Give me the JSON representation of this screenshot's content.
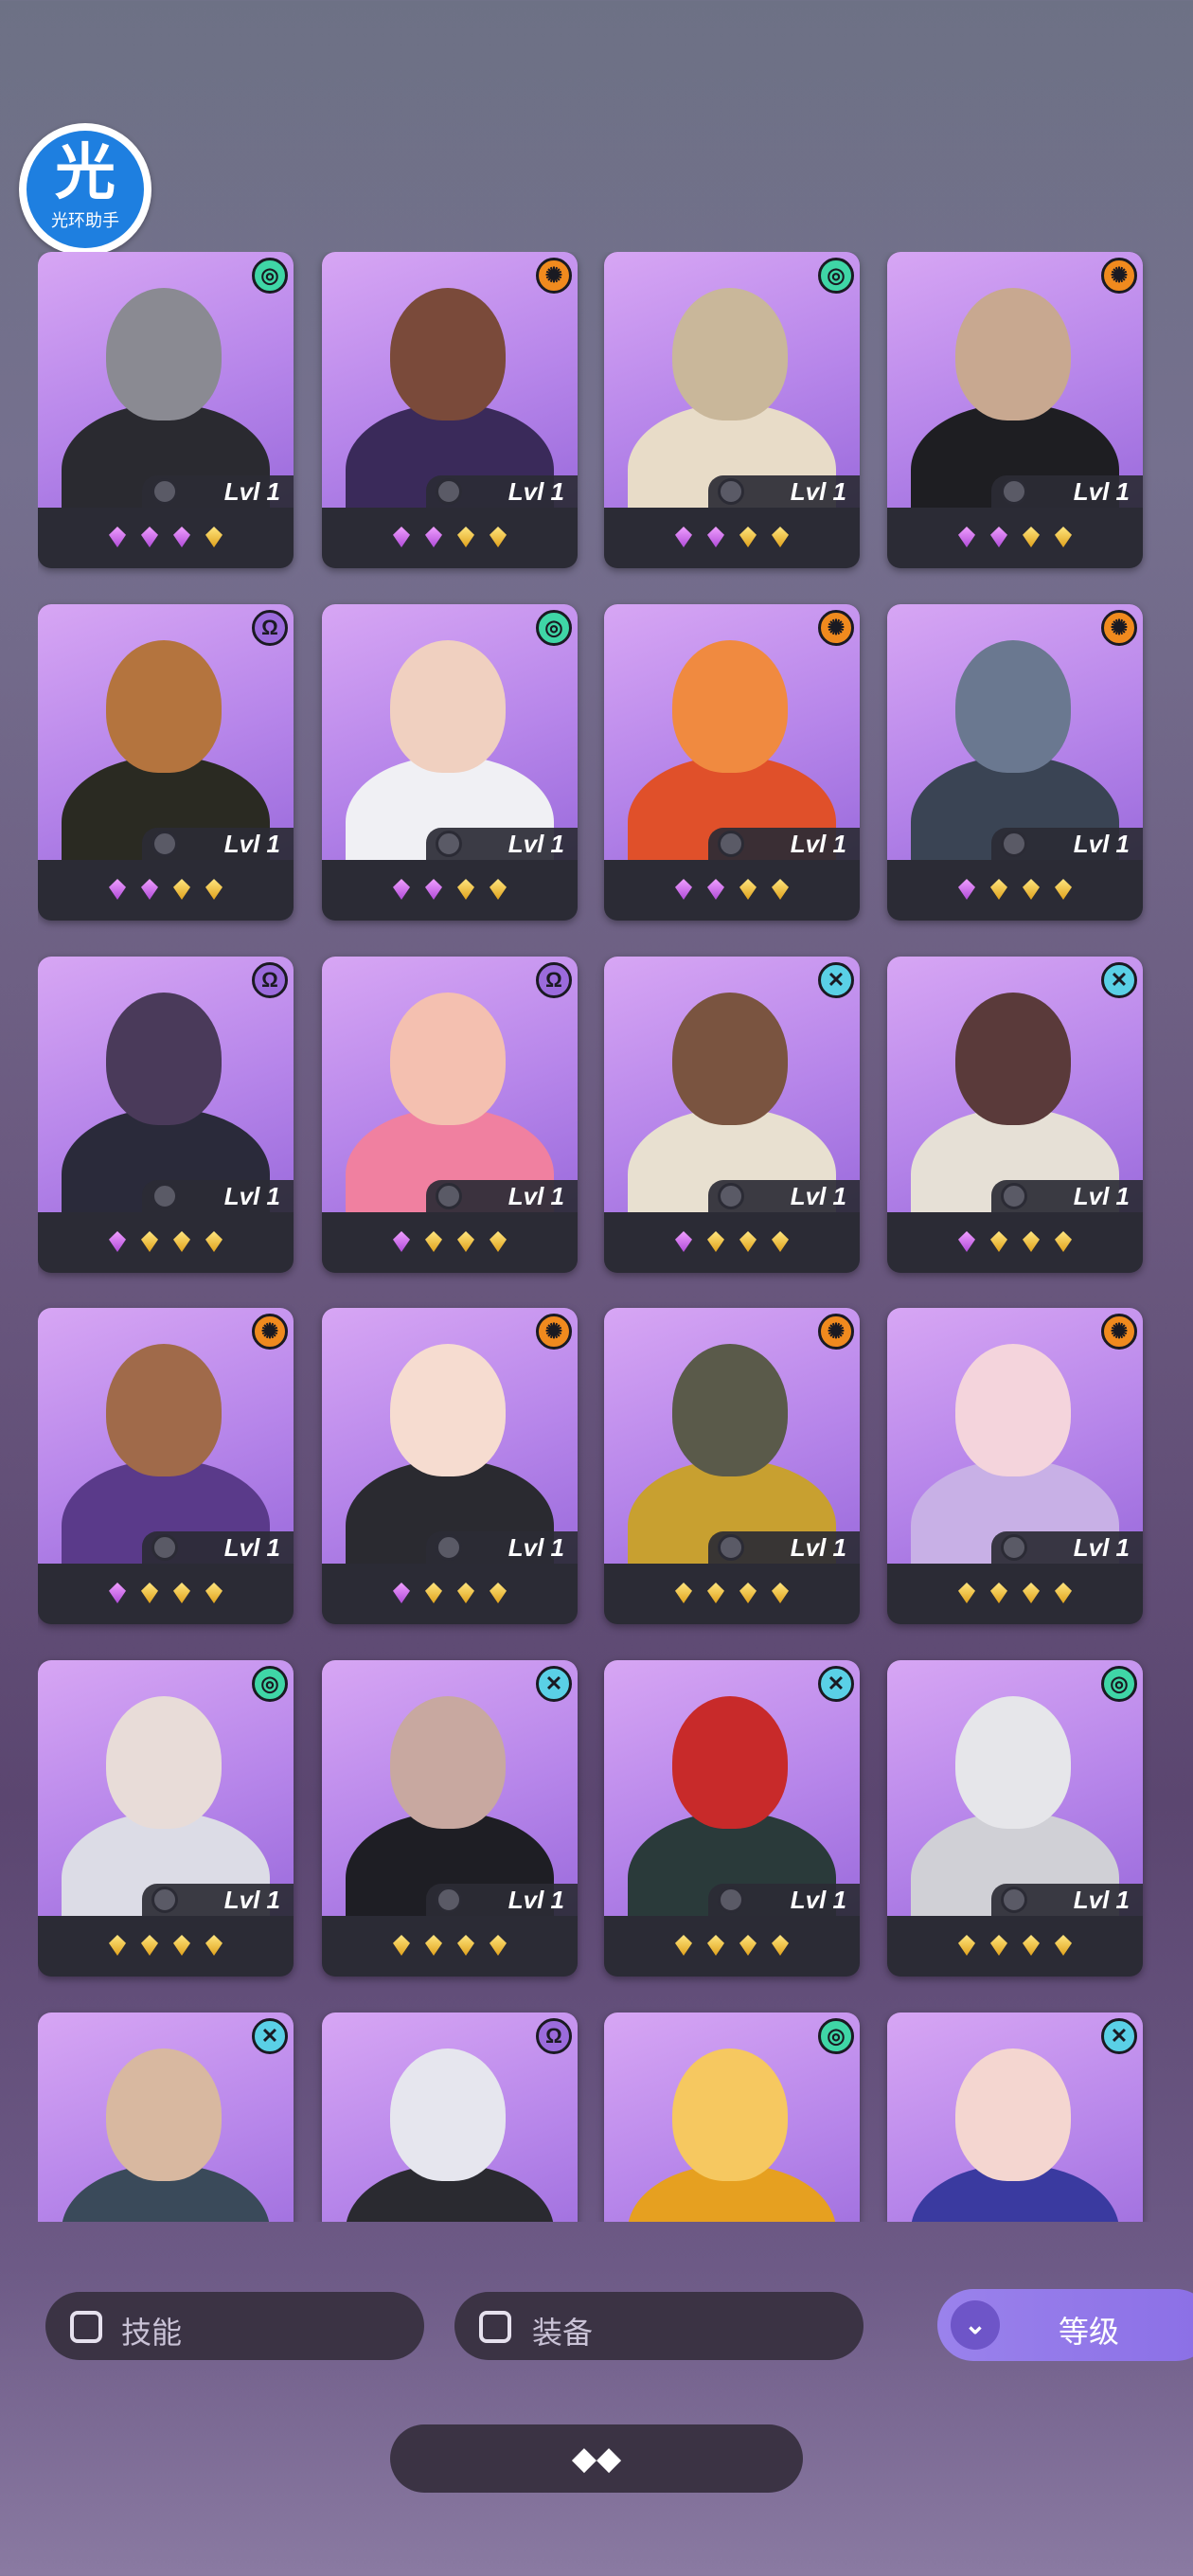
{
  "logo": {
    "glyph": "光",
    "text": "光环助手"
  },
  "level_prefix": "Lvl",
  "cards": [
    {
      "level": "1",
      "faction": "swirl-icon",
      "faction_color": "#3fd6a6",
      "gems": [
        "p",
        "p",
        "p",
        "g"
      ],
      "skin": "#8a8a92",
      "body": "#2a2a30"
    },
    {
      "level": "1",
      "faction": "sun-icon",
      "faction_color": "#f08a1e",
      "gems": [
        "p",
        "p",
        "g",
        "g"
      ],
      "skin": "#7a4a3a",
      "body": "#3a2a5a"
    },
    {
      "level": "1",
      "faction": "swirl-icon",
      "faction_color": "#3fd6a6",
      "gems": [
        "p",
        "p",
        "g",
        "g"
      ],
      "skin": "#c9b79a",
      "body": "#e8dcc8"
    },
    {
      "level": "1",
      "faction": "sun-icon",
      "faction_color": "#f08a1e",
      "gems": [
        "p",
        "p",
        "g",
        "g"
      ],
      "skin": "#c8a890",
      "body": "#1e1e22"
    },
    {
      "level": "1",
      "faction": "warrior-icon",
      "faction_color": "#9b6bdc",
      "gems": [
        "p",
        "p",
        "g",
        "g"
      ],
      "skin": "#b4743e",
      "body": "#2a2a22"
    },
    {
      "level": "1",
      "faction": "swirl-icon",
      "faction_color": "#3fd6a6",
      "gems": [
        "p",
        "p",
        "g",
        "g"
      ],
      "skin": "#f0d0c0",
      "body": "#f0f0f4"
    },
    {
      "level": "1",
      "faction": "sun-icon",
      "faction_color": "#f08a1e",
      "gems": [
        "p",
        "p",
        "g",
        "g"
      ],
      "skin": "#f08a40",
      "body": "#e0502a"
    },
    {
      "level": "1",
      "faction": "sun-icon",
      "faction_color": "#f08a1e",
      "gems": [
        "p",
        "g",
        "g",
        "g"
      ],
      "skin": "#6a7890",
      "body": "#3a4454"
    },
    {
      "level": "1",
      "faction": "warrior-icon",
      "faction_color": "#9b6bdc",
      "gems": [
        "p",
        "g",
        "g",
        "g"
      ],
      "skin": "#4a3a5a",
      "body": "#2a2a3a"
    },
    {
      "level": "1",
      "faction": "warrior-icon",
      "faction_color": "#9b6bdc",
      "gems": [
        "p",
        "g",
        "g",
        "g"
      ],
      "skin": "#f4c0b0",
      "body": "#f080a0"
    },
    {
      "level": "1",
      "faction": "cross-icon",
      "faction_color": "#5ad0e6",
      "gems": [
        "p",
        "g",
        "g",
        "g"
      ],
      "skin": "#7a5440",
      "body": "#e8e0d0"
    },
    {
      "level": "1",
      "faction": "cross-icon",
      "faction_color": "#5ad0e6",
      "gems": [
        "p",
        "g",
        "g",
        "g"
      ],
      "skin": "#5a3a3a",
      "body": "#e6e0d6"
    },
    {
      "level": "1",
      "faction": "sun-icon",
      "faction_color": "#f08a1e",
      "gems": [
        "p",
        "g",
        "g",
        "g"
      ],
      "skin": "#a06a4a",
      "body": "#5a3a8a"
    },
    {
      "level": "1",
      "faction": "sun-icon",
      "faction_color": "#f08a1e",
      "gems": [
        "p",
        "g",
        "g",
        "g"
      ],
      "skin": "#f6dcd0",
      "body": "#2a2a30"
    },
    {
      "level": "1",
      "faction": "sun-icon",
      "faction_color": "#f08a1e",
      "gems": [
        "g",
        "g",
        "g",
        "g"
      ],
      "skin": "#5a5a4a",
      "body": "#c8a030"
    },
    {
      "level": "1",
      "faction": "sun-icon",
      "faction_color": "#f08a1e",
      "gems": [
        "g",
        "g",
        "g",
        "g"
      ],
      "skin": "#f4d4dc",
      "body": "#c8b0e6"
    },
    {
      "level": "1",
      "faction": "swirl-icon",
      "faction_color": "#3fd6a6",
      "gems": [
        "g",
        "g",
        "g",
        "g"
      ],
      "skin": "#e8dcd8",
      "body": "#dcdce6"
    },
    {
      "level": "1",
      "faction": "cross-icon",
      "faction_color": "#5ad0e6",
      "gems": [
        "g",
        "g",
        "g",
        "g"
      ],
      "skin": "#c8a8a0",
      "body": "#1e1e24"
    },
    {
      "level": "1",
      "faction": "cross-icon",
      "faction_color": "#5ad0e6",
      "gems": [
        "g",
        "g",
        "g",
        "g"
      ],
      "skin": "#c82a2a",
      "body": "#2a3a3a"
    },
    {
      "level": "1",
      "faction": "swirl-icon",
      "faction_color": "#3fd6a6",
      "gems": [
        "g",
        "g",
        "g",
        "g"
      ],
      "skin": "#e6e6ea",
      "body": "#d0d0d6"
    },
    {
      "level": "",
      "faction": "cross-icon",
      "faction_color": "#5ad0e6",
      "gems": [],
      "skin": "#d8b8a0",
      "body": "#3a4a5a"
    },
    {
      "level": "",
      "faction": "warrior-icon",
      "faction_color": "#9b6bdc",
      "gems": [],
      "skin": "#e6e6ee",
      "body": "#2a2a30"
    },
    {
      "level": "",
      "faction": "swirl-icon",
      "faction_color": "#3fd6a6",
      "gems": [],
      "skin": "#f6c860",
      "body": "#e6a020"
    },
    {
      "level": "",
      "faction": "cross-icon",
      "faction_color": "#5ad0e6",
      "gems": [],
      "skin": "#f4d6d0",
      "body": "#3a3aa0"
    }
  ],
  "filters": {
    "skill_label": "技能",
    "equip_label": "装备",
    "level_label": "等级"
  }
}
